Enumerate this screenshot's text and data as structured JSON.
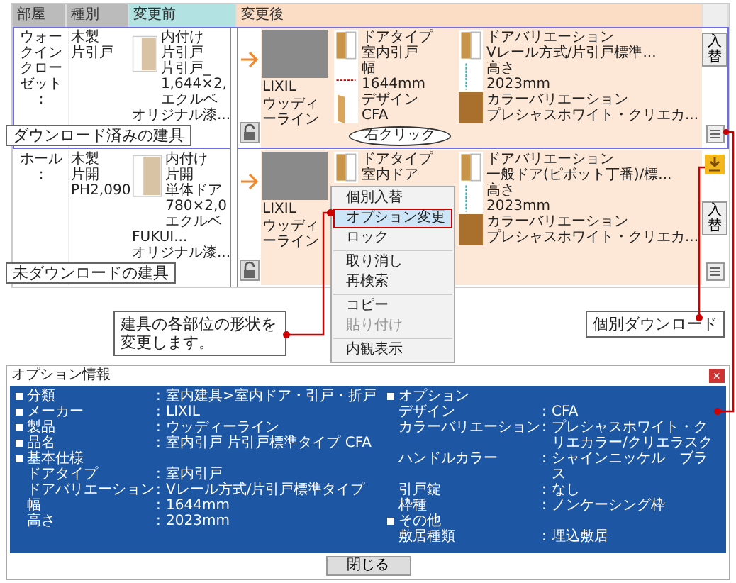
{
  "table": {
    "columns": [
      "部屋",
      "種別",
      "変更前",
      "変更後"
    ],
    "rows": [
      {
        "selected": true,
        "room": "ウォークインクローゼット",
        "room_sub": ":",
        "type_lines": [
          "木製",
          "片引戸"
        ],
        "before_labels": [
          "オリジナル漆..."
        ],
        "before_specs": [
          "内付け",
          "片引戸",
          "片引戸_",
          "1,644×2,",
          "エクルベ"
        ],
        "locked": true,
        "downloaded": true,
        "maker": "LIXIL",
        "product": "ウッディーライン",
        "left_parts": [
          {
            "kind": "door",
            "label": "ドアタイプ",
            "value": "室内引戸"
          },
          {
            "kind": "width",
            "label": "幅",
            "value": "1644mm"
          },
          {
            "kind": "design",
            "label": "デザイン",
            "value": "CFA"
          }
        ],
        "right_parts": [
          {
            "kind": "door",
            "label": "ドアバリエーション",
            "value": "Vレール方式/片引戸標準..."
          },
          {
            "kind": "height",
            "label": "高さ",
            "value": "2023mm"
          },
          {
            "kind": "color",
            "label": "カラーバリエーション",
            "value": "プレシャスホワイト・クリエカ..."
          }
        ],
        "swap_button": "入替"
      },
      {
        "selected": false,
        "room": "ホール",
        "room_sub": ":",
        "type_lines": [
          "木製",
          "片開",
          "PH2,090"
        ],
        "before_labels": [
          "FUKUI...",
          "オリジナル漆..."
        ],
        "before_specs": [
          "内付け",
          "片開",
          "単体ドア",
          "780×2,0",
          "エクルベ"
        ],
        "locked": true,
        "downloaded": false,
        "maker": "LIXIL",
        "product": "ウッディーライン",
        "left_parts": [
          {
            "kind": "door",
            "label": "ドアタイプ",
            "value": "室内ドア"
          }
        ],
        "right_parts": [
          {
            "kind": "door",
            "label": "ドアバリエーション",
            "value": "一般ドア(ピボット丁番)/標..."
          },
          {
            "kind": "height",
            "label": "高さ",
            "value": "2023mm"
          },
          {
            "kind": "color",
            "label": "カラーバリエーション",
            "value": "プレシャスホワイト・クリエカ..."
          }
        ],
        "swap_button": "入替"
      }
    ]
  },
  "notes": {
    "downloaded": "ダウンロード済みの建具",
    "not_downloaded": "未ダウンロードの建具",
    "right_click": "右クリック",
    "shape_change": "建具の各部位の形状を変更します。",
    "individual_download": "個別ダウンロード"
  },
  "context_menu": {
    "groups": [
      [
        {
          "label": "個別入替",
          "selected": false,
          "disabled": false
        },
        {
          "label": "オプション変更",
          "selected": true,
          "disabled": false
        },
        {
          "label": "ロック",
          "selected": false,
          "disabled": false
        }
      ],
      [
        {
          "label": "取り消し",
          "selected": false,
          "disabled": false
        },
        {
          "label": "再検索",
          "selected": false,
          "disabled": false
        }
      ],
      [
        {
          "label": "コピー",
          "selected": false,
          "disabled": false
        },
        {
          "label": "貼り付け",
          "selected": false,
          "disabled": true
        }
      ],
      [
        {
          "label": "内観表示",
          "selected": false,
          "disabled": false
        }
      ]
    ]
  },
  "dialog": {
    "title": "オプション情報",
    "close": "×",
    "separator": ":",
    "left": [
      {
        "bullet": true,
        "label": "分類",
        "value": "室内建具>室内ドア・引戸・折戸"
      },
      {
        "bullet": true,
        "label": "メーカー",
        "value": "LIXIL"
      },
      {
        "bullet": true,
        "label": "製品",
        "value": "ウッディーライン"
      },
      {
        "bullet": true,
        "label": "品名",
        "value": "室内引戸 片引戸標準タイプ CFA"
      },
      {
        "bullet": true,
        "label": "基本仕様"
      },
      {
        "bullet": false,
        "label": "ドアタイプ",
        "value": "室内引戸"
      },
      {
        "bullet": false,
        "label": "ドアバリエーション",
        "value": "Vレール方式/片引戸標準タイプ"
      },
      {
        "bullet": false,
        "label": "幅",
        "value": "1644mm"
      },
      {
        "bullet": false,
        "label": "高さ",
        "value": "2023mm"
      }
    ],
    "right": [
      {
        "bullet": true,
        "label": "オプション"
      },
      {
        "bullet": false,
        "label": "デザイン",
        "value": "CFA"
      },
      {
        "bullet": false,
        "label": "カラーバリエーション",
        "value": "プレシャスホワイト・クリエカラー/クリエラスク"
      },
      {
        "bullet": false,
        "label": "ハンドルカラー",
        "value": "シャインニッケル　ブラス"
      },
      {
        "bullet": false,
        "label": "引戸錠",
        "value": "なし"
      },
      {
        "bullet": false,
        "label": "枠種",
        "value": "ノンケーシング枠"
      },
      {
        "bullet": true,
        "label": "その他"
      },
      {
        "bullet": false,
        "label": "敷居種類",
        "value": "埋込敷居"
      }
    ],
    "button": "閉じる"
  }
}
